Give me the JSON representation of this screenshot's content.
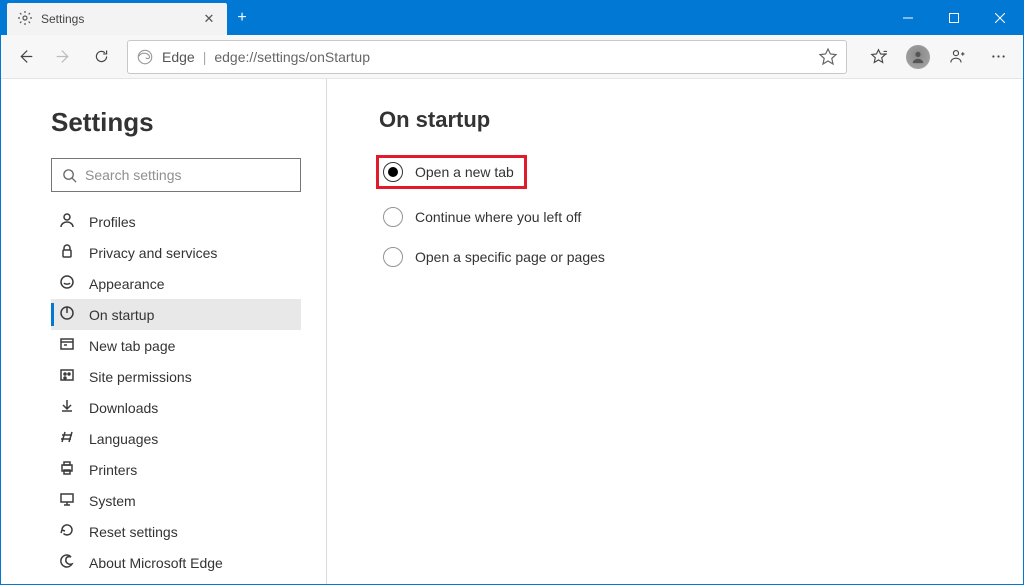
{
  "tab": {
    "title": "Settings"
  },
  "addressbar": {
    "prefix": "Edge",
    "url": "edge://settings/onStartup"
  },
  "search": {
    "placeholder": "Search settings"
  },
  "sidebar": {
    "title": "Settings",
    "items": [
      {
        "label": "Profiles"
      },
      {
        "label": "Privacy and services"
      },
      {
        "label": "Appearance"
      },
      {
        "label": "On startup"
      },
      {
        "label": "New tab page"
      },
      {
        "label": "Site permissions"
      },
      {
        "label": "Downloads"
      },
      {
        "label": "Languages"
      },
      {
        "label": "Printers"
      },
      {
        "label": "System"
      },
      {
        "label": "Reset settings"
      },
      {
        "label": "About Microsoft Edge"
      }
    ],
    "active_index": 3
  },
  "main": {
    "title": "On startup",
    "options": [
      {
        "label": "Open a new tab",
        "checked": true,
        "highlight": true
      },
      {
        "label": "Continue where you left off",
        "checked": false,
        "highlight": false
      },
      {
        "label": "Open a specific page or pages",
        "checked": false,
        "highlight": false
      }
    ]
  }
}
